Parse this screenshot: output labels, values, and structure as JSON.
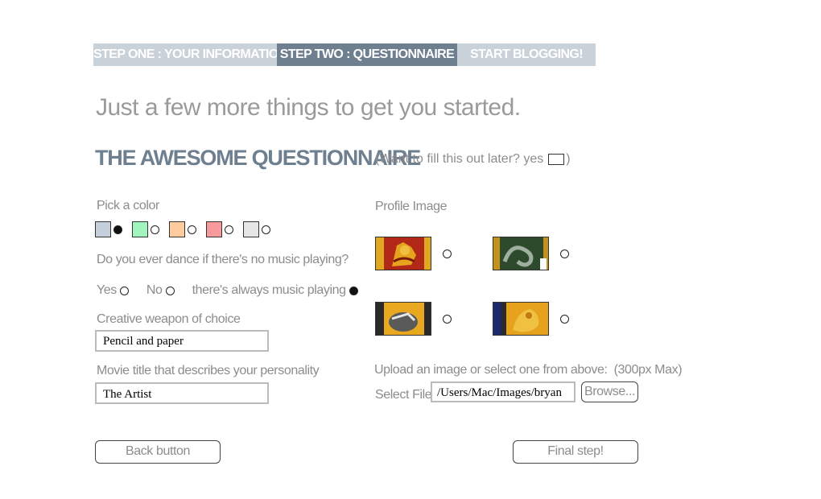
{
  "steps": [
    {
      "label": "STEP ONE : YOUR INFORMATION",
      "active": false
    },
    {
      "label": "STEP TWO : QUESTIONNAIRE",
      "active": true
    },
    {
      "label": "START BLOGGING!",
      "active": false
    }
  ],
  "intro": "Just a few more things to get you started.",
  "questionnaire": {
    "title": "THE AWESOME QUESTIONNAIRE",
    "later_prefix": "(Want to fill this out later? yes",
    "later_suffix": ")",
    "later_checked": false
  },
  "color_picker": {
    "label": "Pick a color",
    "swatches": [
      {
        "color": "#c4cfdb",
        "selected": true
      },
      {
        "color": "#a3f5c0",
        "selected": false
      },
      {
        "color": "#fdcb9d",
        "selected": false
      },
      {
        "color": "#f8999b",
        "selected": false
      },
      {
        "color": "#e6e6e6",
        "selected": false
      }
    ]
  },
  "dance_question": {
    "label": "Do you ever dance if there's no music playing?",
    "options": [
      {
        "label": "Yes",
        "selected": false
      },
      {
        "label": "No",
        "selected": false
      },
      {
        "label": "there's always music playing",
        "selected": true
      }
    ]
  },
  "weapon": {
    "label": "Creative weapon of choice",
    "value": "Pencil and paper"
  },
  "movie": {
    "label": "Movie title that describes your personality",
    "value": "The Artist"
  },
  "profile_image": {
    "label": "Profile Image",
    "images": [
      {
        "name": "red-lion-crest",
        "selected": false
      },
      {
        "name": "green-serpent-crest",
        "selected": false
      },
      {
        "name": "yellow-badger-crest",
        "selected": false
      },
      {
        "name": "blue-eagle-crest",
        "selected": false
      }
    ]
  },
  "upload": {
    "label": "Upload an image or select one from above:",
    "max_note": "(300px Max)",
    "select_file_label": "Select File",
    "file_path": "/Users/Mac/Images/bryan",
    "browse_label": "Browse..."
  },
  "nav": {
    "back_label": "Back button",
    "next_label": "Final step!"
  }
}
